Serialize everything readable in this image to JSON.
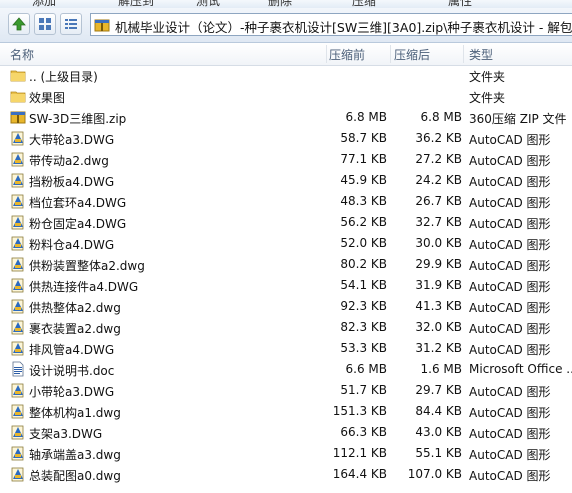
{
  "toolbar": {
    "buttons": [
      "添加",
      "解压到",
      "测试",
      "删除",
      "压缩",
      "属性"
    ]
  },
  "address": {
    "path": "机械毕业设计（论文）-种子裹衣机设计[SW三维][3A0].zip\\种子裹衣机设计 - 解包大小"
  },
  "columns": {
    "name": "名称",
    "size": "压缩前",
    "packed": "压缩后",
    "type": "类型"
  },
  "files": [
    {
      "icon": "folder-up-icon",
      "name": ".. (上级目录)",
      "size": "",
      "packed": "",
      "type": "文件夹"
    },
    {
      "icon": "folder-icon",
      "name": "效果图",
      "size": "",
      "packed": "",
      "type": "文件夹"
    },
    {
      "icon": "zip-icon",
      "name": "SW-3D三维图.zip",
      "size": "6.8 MB",
      "packed": "6.8 MB",
      "type": "360压缩 ZIP 文件"
    },
    {
      "icon": "dwg-icon",
      "name": "大带轮a3.DWG",
      "size": "58.7 KB",
      "packed": "36.2 KB",
      "type": "AutoCAD 图形"
    },
    {
      "icon": "dwg-icon",
      "name": "带传动a2.dwg",
      "size": "77.1 KB",
      "packed": "27.2 KB",
      "type": "AutoCAD 图形"
    },
    {
      "icon": "dwg-icon",
      "name": "挡粉板a4.DWG",
      "size": "45.9 KB",
      "packed": "24.2 KB",
      "type": "AutoCAD 图形"
    },
    {
      "icon": "dwg-icon",
      "name": "档位套环a4.DWG",
      "size": "48.3 KB",
      "packed": "26.7 KB",
      "type": "AutoCAD 图形"
    },
    {
      "icon": "dwg-icon",
      "name": "粉仓固定a4.DWG",
      "size": "56.2 KB",
      "packed": "32.7 KB",
      "type": "AutoCAD 图形"
    },
    {
      "icon": "dwg-icon",
      "name": "粉料仓a4.DWG",
      "size": "52.0 KB",
      "packed": "30.0 KB",
      "type": "AutoCAD 图形"
    },
    {
      "icon": "dwg-icon",
      "name": "供粉装置整体a2.dwg",
      "size": "80.2 KB",
      "packed": "29.9 KB",
      "type": "AutoCAD 图形"
    },
    {
      "icon": "dwg-icon",
      "name": "供热连接件a4.DWG",
      "size": "54.1 KB",
      "packed": "31.9 KB",
      "type": "AutoCAD 图形"
    },
    {
      "icon": "dwg-icon",
      "name": "供热整体a2.dwg",
      "size": "92.3 KB",
      "packed": "41.3 KB",
      "type": "AutoCAD 图形"
    },
    {
      "icon": "dwg-icon",
      "name": "裹衣装置a2.dwg",
      "size": "82.3 KB",
      "packed": "32.0 KB",
      "type": "AutoCAD 图形"
    },
    {
      "icon": "dwg-icon",
      "name": "排风管a4.DWG",
      "size": "53.3 KB",
      "packed": "31.2 KB",
      "type": "AutoCAD 图形"
    },
    {
      "icon": "doc-icon",
      "name": "设计说明书.doc",
      "size": "6.6 MB",
      "packed": "1.6 MB",
      "type": "Microsoft Office ..."
    },
    {
      "icon": "dwg-icon",
      "name": "小带轮a3.DWG",
      "size": "51.7 KB",
      "packed": "29.7 KB",
      "type": "AutoCAD 图形"
    },
    {
      "icon": "dwg-icon",
      "name": "整体机构a1.dwg",
      "size": "151.3 KB",
      "packed": "84.4 KB",
      "type": "AutoCAD 图形"
    },
    {
      "icon": "dwg-icon",
      "name": "支架a3.DWG",
      "size": "66.3 KB",
      "packed": "43.0 KB",
      "type": "AutoCAD 图形"
    },
    {
      "icon": "dwg-icon",
      "name": "轴承端盖a3.dwg",
      "size": "112.1 KB",
      "packed": "55.1 KB",
      "type": "AutoCAD 图形"
    },
    {
      "icon": "dwg-icon",
      "name": "总装配图a0.dwg",
      "size": "164.4 KB",
      "packed": "107.0 KB",
      "type": "AutoCAD 图形"
    }
  ]
}
